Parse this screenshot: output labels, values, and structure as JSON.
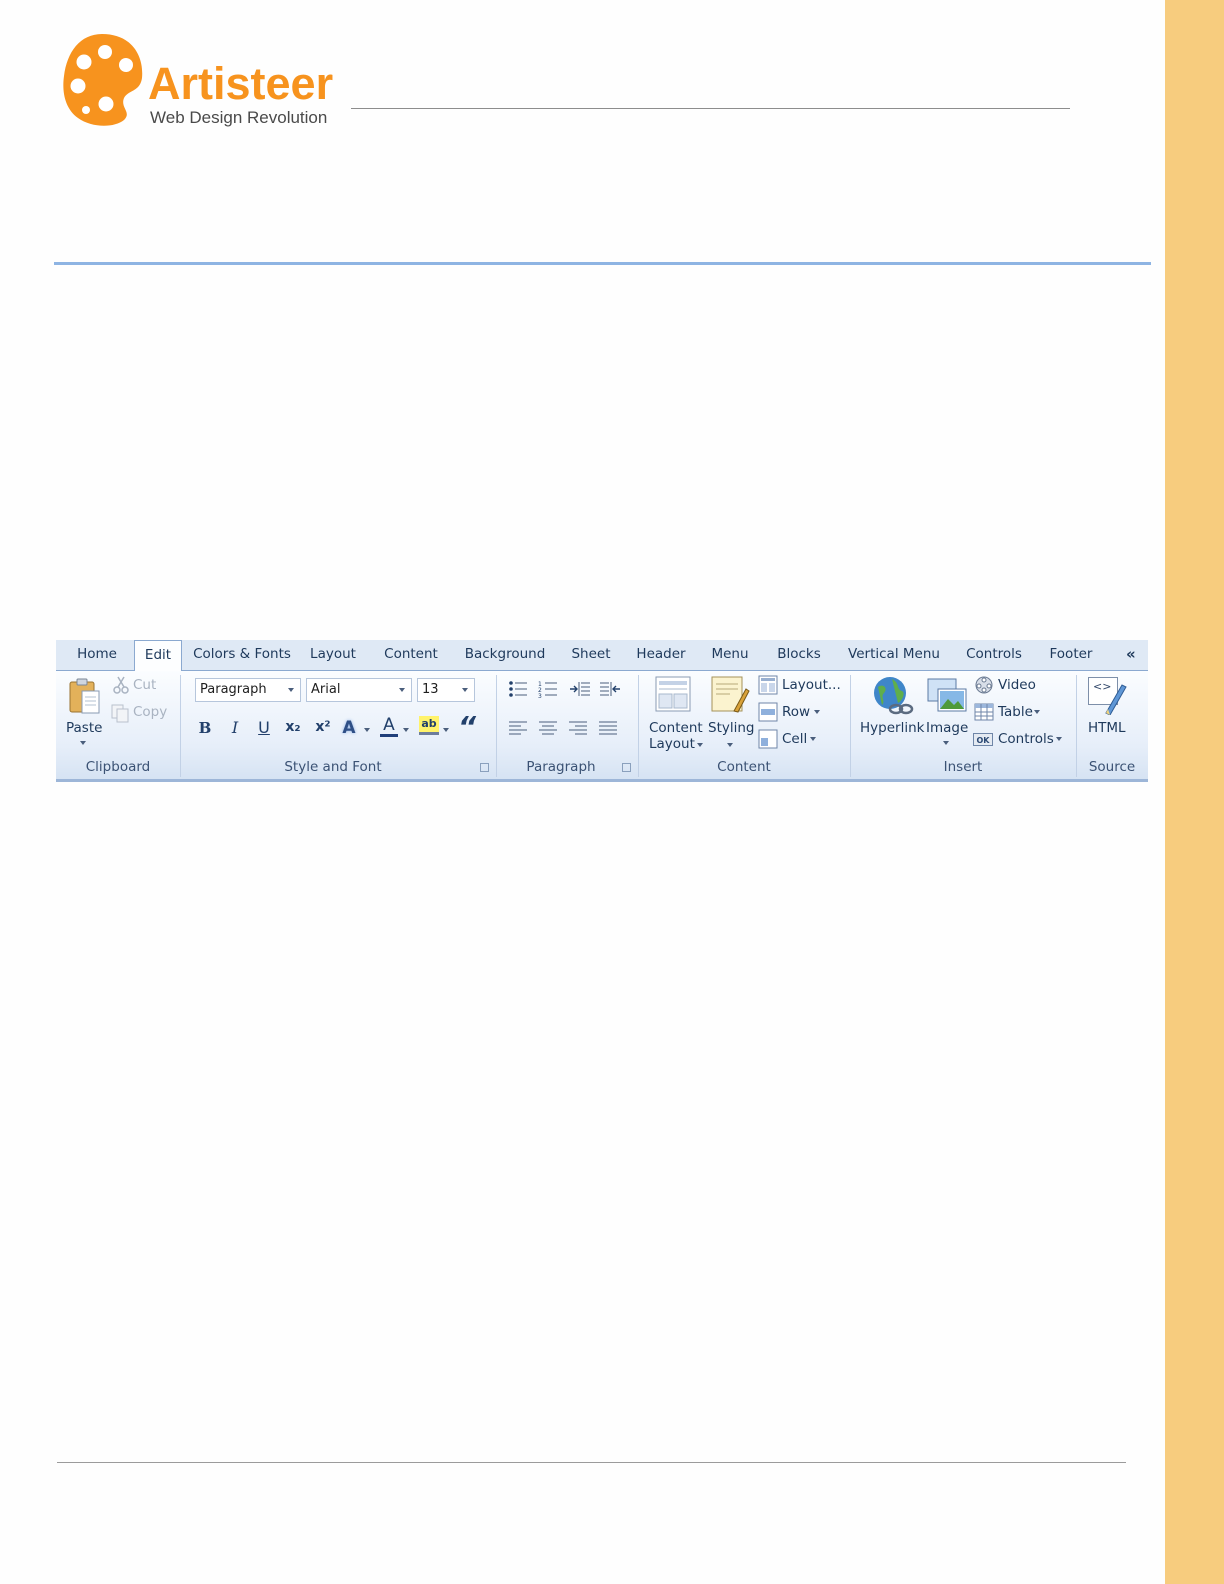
{
  "colors": {
    "side_band": "#f7cc7e",
    "logo_orange": "#f7931e",
    "blue_rule": "#8eb4e3"
  },
  "logo": {
    "name": "Artisteer",
    "tagline": "Web Design Revolution"
  },
  "ribbon": {
    "tabs": [
      {
        "label": "Home"
      },
      {
        "label": "Edit",
        "active": true
      },
      {
        "label": "Colors & Fonts"
      },
      {
        "label": "Layout"
      },
      {
        "label": "Content"
      },
      {
        "label": "Background"
      },
      {
        "label": "Sheet"
      },
      {
        "label": "Header"
      },
      {
        "label": "Menu"
      },
      {
        "label": "Blocks"
      },
      {
        "label": "Vertical Menu"
      },
      {
        "label": "Controls"
      },
      {
        "label": "Footer"
      }
    ],
    "collapse_glyph": "«",
    "groups": {
      "clipboard": {
        "label": "Clipboard",
        "paste": "Paste",
        "cut": "Cut",
        "copy": "Copy"
      },
      "style_font": {
        "label": "Style and Font",
        "style_value": "Paragraph",
        "font_value": "Arial",
        "size_value": "13",
        "bold_glyph": "B",
        "italic_glyph": "I",
        "underline_glyph": "U",
        "subscript_glyph": "x₂",
        "superscript_glyph": "x²",
        "text_effect_glyph": "A",
        "font_color_glyph": "A",
        "highlight_glyph": "ab",
        "quote_glyph": "“"
      },
      "paragraph": {
        "label": "Paragraph"
      },
      "content": {
        "label": "Content",
        "content_layout_line1": "Content",
        "content_layout_line2": "Layout",
        "styling": "Styling",
        "layout": "Layout...",
        "row": "Row",
        "cell": "Cell"
      },
      "insert": {
        "label": "Insert",
        "hyperlink": "Hyperlink",
        "image": "Image",
        "video": "Video",
        "table": "Table",
        "controls": "Controls",
        "ok_badge": "OK"
      },
      "source": {
        "label": "Source",
        "html": "HTML",
        "code_glyph": "<>"
      }
    }
  }
}
